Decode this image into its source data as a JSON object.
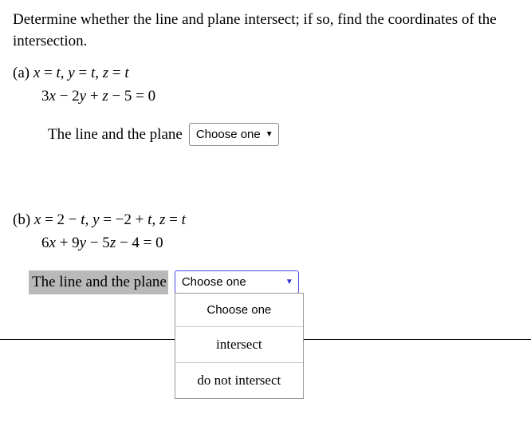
{
  "prompt": "Determine whether the line and plane intersect; if so, find the coordinates of the intersection.",
  "parts": {
    "a": {
      "label": "(a)",
      "line_eq": "x = t, y = t, z = t",
      "plane_eq": "3x − 2y + z − 5 = 0",
      "answer_prefix": "The line and the plane",
      "select_value": "Choose one"
    },
    "b": {
      "label": "(b)",
      "line_eq": "x = 2 − t, y = −2 + t, z = t",
      "plane_eq": "6x + 9y − 5z − 4 = 0",
      "answer_prefix": "The line and the plane",
      "select_value": "Choose one"
    }
  },
  "dropdown_options": [
    "Choose one",
    "intersect",
    "do not intersect"
  ]
}
